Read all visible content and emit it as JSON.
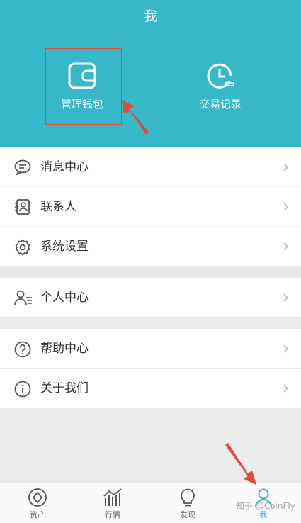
{
  "header": {
    "title": "我",
    "actions": [
      {
        "label": "管理钱包",
        "icon": "wallet-icon"
      },
      {
        "label": "交易记录",
        "icon": "clock-icon"
      }
    ]
  },
  "menu": {
    "group1": [
      {
        "label": "消息中心",
        "icon": "message-icon"
      },
      {
        "label": "联系人",
        "icon": "contacts-icon"
      },
      {
        "label": "系统设置",
        "icon": "gear-icon"
      }
    ],
    "group2": [
      {
        "label": "个人中心",
        "icon": "user-list-icon"
      }
    ],
    "group3": [
      {
        "label": "帮助中心",
        "icon": "help-icon"
      },
      {
        "label": "关于我们",
        "icon": "info-icon"
      }
    ]
  },
  "tabbar": {
    "tabs": [
      {
        "label": "资产",
        "icon": "diamond-icon"
      },
      {
        "label": "行情",
        "icon": "chart-icon"
      },
      {
        "label": "发现",
        "icon": "bulb-icon"
      },
      {
        "label": "我",
        "icon": "user-icon",
        "active": true
      }
    ]
  },
  "watermark": "知乎 @CoinFly",
  "colors": {
    "accent": "#37b8c9",
    "annotation": "#e24b3b"
  }
}
